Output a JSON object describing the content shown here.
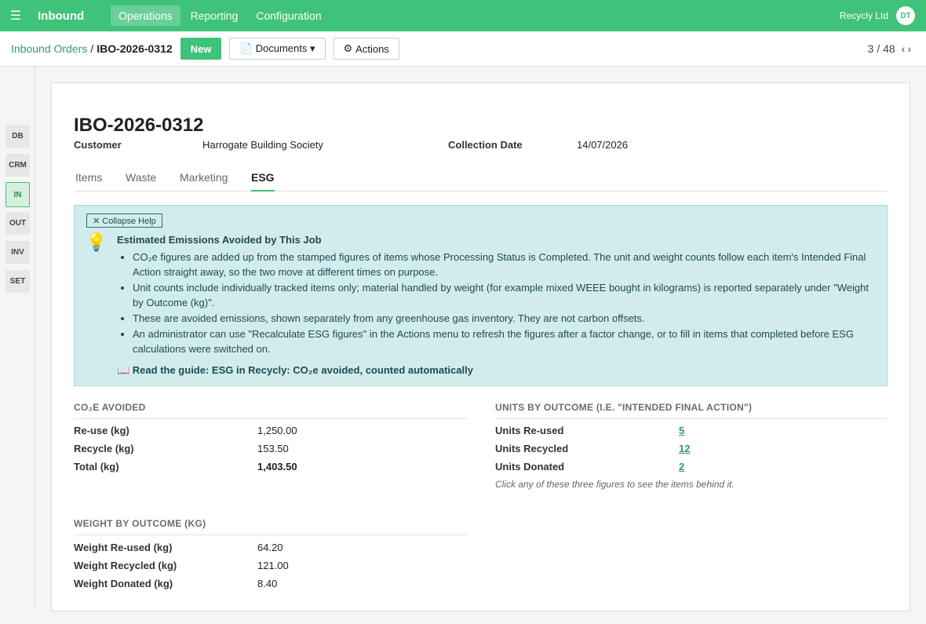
{
  "navbar": {
    "app_name": "Inbound",
    "menu": [
      "Operations",
      "Reporting",
      "Configuration"
    ],
    "company": "Recycly Ltd",
    "user_initials": "DT"
  },
  "control": {
    "breadcrumb_parent": "Inbound Orders",
    "breadcrumb_sep": "/",
    "breadcrumb_current": "IBO-2026-0312",
    "new_label": "New",
    "documents_label": "Documents ▾",
    "actions_label": "Actions",
    "pager": "3 / 48"
  },
  "rail": [
    "DB",
    "CRM",
    "IN",
    "OUT",
    "INV",
    "SET"
  ],
  "record": {
    "title": "IBO-2026-0312",
    "customer_label": "Customer",
    "customer_value": "Harrogate Building Society",
    "date_label": "Collection Date",
    "date_value": "14/07/2026"
  },
  "tabs": [
    "Items",
    "Waste",
    "Marketing",
    "ESG"
  ],
  "help": {
    "collapse_label": "✕ Collapse Help",
    "title": "Estimated Emissions Avoided by This Job",
    "bullets": [
      "CO₂e figures are added up from the stamped figures of items whose Processing Status is Completed. The unit and weight counts follow each item's Intended Final Action straight away, so the two move at different times on purpose.",
      "Unit counts include individually tracked items only; material handled by weight (for example mixed WEEE bought in kilograms) is reported separately under \"Weight by Outcome (kg)\".",
      "These are avoided emissions, shown separately from any greenhouse gas inventory. They are not carbon offsets.",
      "An administrator can use \"Recalculate ESG figures\" in the Actions menu to refresh the figures after a factor change, or to fill in items that completed before ESG calculations were switched on."
    ],
    "guide_link": "📖 Read the guide: ESG in Recycly: CO₂e avoided, counted automatically"
  },
  "co2": {
    "heading": "CO₂E AVOIDED",
    "rows": [
      {
        "label": "Re-use (kg)",
        "value": "1,250.00"
      },
      {
        "label": "Recycle (kg)",
        "value": "153.50"
      },
      {
        "label": "Total (kg)",
        "value": "1,403.50"
      }
    ]
  },
  "units": {
    "heading": "UNITS BY OUTCOME (I.E. \"INTENDED FINAL ACTION\")",
    "rows": [
      {
        "label": "Units Re-used",
        "value": "5"
      },
      {
        "label": "Units Recycled",
        "value": "12"
      },
      {
        "label": "Units Donated",
        "value": "2"
      }
    ],
    "note": "Click any of these three figures to see the items behind it."
  },
  "weight": {
    "heading": "WEIGHT BY OUTCOME (KG)",
    "rows": [
      {
        "label": "Weight Re-used (kg)",
        "value": "64.20"
      },
      {
        "label": "Weight Recycled (kg)",
        "value": "121.00"
      },
      {
        "label": "Weight Donated (kg)",
        "value": "8.40"
      }
    ]
  }
}
